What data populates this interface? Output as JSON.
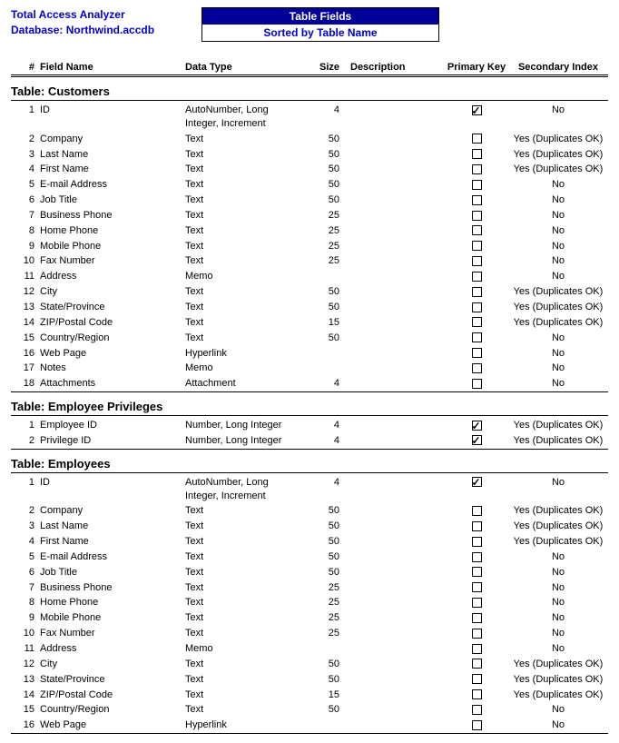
{
  "header": {
    "app_name": "Total Access Analyzer",
    "db_label": "Database: Northwind.accdb",
    "title": "Table Fields",
    "subtitle": "Sorted by Table Name"
  },
  "columns": {
    "num": "#",
    "field": "Field Name",
    "type": "Data Type",
    "size": "Size",
    "desc": "Description",
    "pk": "Primary Key",
    "idx": "Secondary Index"
  },
  "tables": [
    {
      "name": "Table: Customers",
      "rows": [
        {
          "n": "1",
          "f": "ID",
          "t": "AutoNumber, Long Integer, Increment",
          "s": "4",
          "pk": true,
          "idx": "No"
        },
        {
          "n": "2",
          "f": "Company",
          "t": "Text",
          "s": "50",
          "pk": false,
          "idx": "Yes (Duplicates OK)"
        },
        {
          "n": "3",
          "f": "Last Name",
          "t": "Text",
          "s": "50",
          "pk": false,
          "idx": "Yes (Duplicates OK)"
        },
        {
          "n": "4",
          "f": "First Name",
          "t": "Text",
          "s": "50",
          "pk": false,
          "idx": "Yes (Duplicates OK)"
        },
        {
          "n": "5",
          "f": "E-mail Address",
          "t": "Text",
          "s": "50",
          "pk": false,
          "idx": "No"
        },
        {
          "n": "6",
          "f": "Job Title",
          "t": "Text",
          "s": "50",
          "pk": false,
          "idx": "No"
        },
        {
          "n": "7",
          "f": "Business Phone",
          "t": "Text",
          "s": "25",
          "pk": false,
          "idx": "No"
        },
        {
          "n": "8",
          "f": "Home Phone",
          "t": "Text",
          "s": "25",
          "pk": false,
          "idx": "No"
        },
        {
          "n": "9",
          "f": "Mobile Phone",
          "t": "Text",
          "s": "25",
          "pk": false,
          "idx": "No"
        },
        {
          "n": "10",
          "f": "Fax Number",
          "t": "Text",
          "s": "25",
          "pk": false,
          "idx": "No"
        },
        {
          "n": "11",
          "f": "Address",
          "t": "Memo",
          "s": "",
          "pk": false,
          "idx": "No"
        },
        {
          "n": "12",
          "f": "City",
          "t": "Text",
          "s": "50",
          "pk": false,
          "idx": "Yes (Duplicates OK)"
        },
        {
          "n": "13",
          "f": "State/Province",
          "t": "Text",
          "s": "50",
          "pk": false,
          "idx": "Yes (Duplicates OK)"
        },
        {
          "n": "14",
          "f": "ZIP/Postal Code",
          "t": "Text",
          "s": "15",
          "pk": false,
          "idx": "Yes (Duplicates OK)"
        },
        {
          "n": "15",
          "f": "Country/Region",
          "t": "Text",
          "s": "50",
          "pk": false,
          "idx": "No"
        },
        {
          "n": "16",
          "f": "Web Page",
          "t": "Hyperlink",
          "s": "",
          "pk": false,
          "idx": "No"
        },
        {
          "n": "17",
          "f": "Notes",
          "t": "Memo",
          "s": "",
          "pk": false,
          "idx": "No"
        },
        {
          "n": "18",
          "f": "Attachments",
          "t": "Attachment",
          "s": "4",
          "pk": false,
          "idx": "No"
        }
      ]
    },
    {
      "name": "Table: Employee Privileges",
      "rows": [
        {
          "n": "1",
          "f": "Employee ID",
          "t": "Number, Long Integer",
          "s": "4",
          "pk": true,
          "idx": "Yes (Duplicates OK)"
        },
        {
          "n": "2",
          "f": "Privilege ID",
          "t": "Number, Long Integer",
          "s": "4",
          "pk": true,
          "idx": "Yes (Duplicates OK)"
        }
      ]
    },
    {
      "name": "Table: Employees",
      "rows": [
        {
          "n": "1",
          "f": "ID",
          "t": "AutoNumber, Long Integer, Increment",
          "s": "4",
          "pk": true,
          "idx": "No"
        },
        {
          "n": "2",
          "f": "Company",
          "t": "Text",
          "s": "50",
          "pk": false,
          "idx": "Yes (Duplicates OK)"
        },
        {
          "n": "3",
          "f": "Last Name",
          "t": "Text",
          "s": "50",
          "pk": false,
          "idx": "Yes (Duplicates OK)"
        },
        {
          "n": "4",
          "f": "First Name",
          "t": "Text",
          "s": "50",
          "pk": false,
          "idx": "Yes (Duplicates OK)"
        },
        {
          "n": "5",
          "f": "E-mail Address",
          "t": "Text",
          "s": "50",
          "pk": false,
          "idx": "No"
        },
        {
          "n": "6",
          "f": "Job Title",
          "t": "Text",
          "s": "50",
          "pk": false,
          "idx": "No"
        },
        {
          "n": "7",
          "f": "Business Phone",
          "t": "Text",
          "s": "25",
          "pk": false,
          "idx": "No"
        },
        {
          "n": "8",
          "f": "Home Phone",
          "t": "Text",
          "s": "25",
          "pk": false,
          "idx": "No"
        },
        {
          "n": "9",
          "f": "Mobile Phone",
          "t": "Text",
          "s": "25",
          "pk": false,
          "idx": "No"
        },
        {
          "n": "10",
          "f": "Fax Number",
          "t": "Text",
          "s": "25",
          "pk": false,
          "idx": "No"
        },
        {
          "n": "11",
          "f": "Address",
          "t": "Memo",
          "s": "",
          "pk": false,
          "idx": "No"
        },
        {
          "n": "12",
          "f": "City",
          "t": "Text",
          "s": "50",
          "pk": false,
          "idx": "Yes (Duplicates OK)"
        },
        {
          "n": "13",
          "f": "State/Province",
          "t": "Text",
          "s": "50",
          "pk": false,
          "idx": "Yes (Duplicates OK)"
        },
        {
          "n": "14",
          "f": "ZIP/Postal Code",
          "t": "Text",
          "s": "15",
          "pk": false,
          "idx": "Yes (Duplicates OK)"
        },
        {
          "n": "15",
          "f": "Country/Region",
          "t": "Text",
          "s": "50",
          "pk": false,
          "idx": "No"
        },
        {
          "n": "16",
          "f": "Web Page",
          "t": "Hyperlink",
          "s": "",
          "pk": false,
          "idx": "No"
        }
      ]
    }
  ]
}
